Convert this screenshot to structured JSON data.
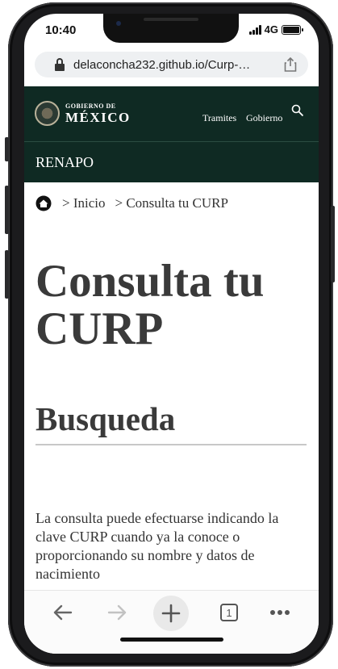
{
  "status": {
    "time": "10:40",
    "network": "4G"
  },
  "browser": {
    "url": "delaconcha232.github.io/Curp-…"
  },
  "gov_header": {
    "brand_small": "GOBIERNO DE",
    "brand_big": "MÉXICO",
    "nav": [
      "Tramites",
      "Gobierno"
    ],
    "section": "RENAPO",
    "colors": {
      "header_bg": "#0f2a23"
    }
  },
  "breadcrumb": {
    "items": [
      "> Inicio",
      "> Consulta tu CURP"
    ]
  },
  "main": {
    "title": "Consulta tu CURP",
    "subtitle": "Busqueda",
    "description": "La consulta puede efectuarse indicando la clave CURP cuando ya la conoce o proporcionando su nombre y datos de nacimiento"
  },
  "toolbar": {
    "tab_count": "1"
  },
  "icons": [
    "lock-icon",
    "share-icon",
    "search-icon",
    "home-icon",
    "back-arrow-icon",
    "forward-arrow-icon",
    "plus-icon",
    "tabs-icon",
    "more-icon"
  ]
}
